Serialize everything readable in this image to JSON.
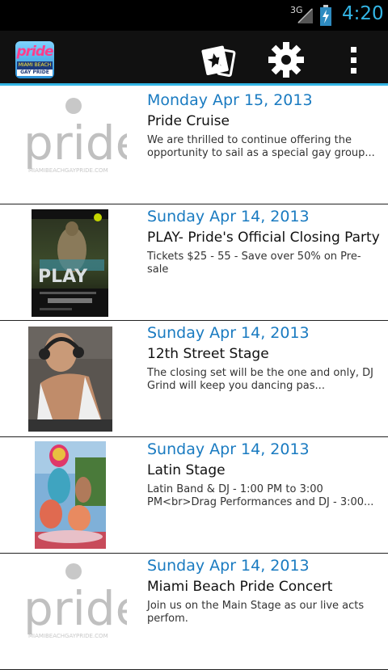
{
  "status_bar": {
    "network": "3G",
    "time": "4:20",
    "accent_color": "#33b5e5"
  },
  "action_bar": {
    "logo": {
      "line1": "pride",
      "line2": "MIAMI BEACH",
      "line3": "GAY PRIDE"
    },
    "icons": [
      "ticket-icon",
      "gear-icon",
      "overflow-menu-icon"
    ]
  },
  "events": [
    {
      "date": "Monday Apr 15, 2013",
      "title": "Pride Cruise",
      "description": "We are thrilled to continue offering the opportunity to sail as a special gay group...",
      "thumbnail": "pride-logo",
      "logo_text": "pride",
      "logo_url": "MIAMIBEACHGAYPRIDE.COM"
    },
    {
      "date": "Sunday Apr 14, 2013",
      "title": "PLAY- Pride's Official Closing Party",
      "description": "Tickets $25 - 55 - Save over 50% on Pre-sale",
      "thumbnail": "play-poster",
      "poster_text": "PLAY"
    },
    {
      "date": "Sunday Apr 14, 2013",
      "title": "12th Street Stage",
      "description": "The closing set will be the one and only, DJ Grind will keep you dancing pas...",
      "thumbnail": "dj-photo"
    },
    {
      "date": "Sunday Apr 14, 2013",
      "title": "Latin Stage",
      "description": "Latin Band & DJ - 1:00 PM to 3:00 PM<br>Drag Performances and DJ - 3:00...",
      "thumbnail": "latin-photo"
    },
    {
      "date": "Sunday Apr 14, 2013",
      "title": "Miami Beach Pride Concert",
      "description": "Join us on the Main Stage as our live acts perfom.",
      "thumbnail": "pride-logo",
      "logo_text": "pride",
      "logo_url": "MIAMIBEACHGAYPRIDE.COM"
    }
  ]
}
